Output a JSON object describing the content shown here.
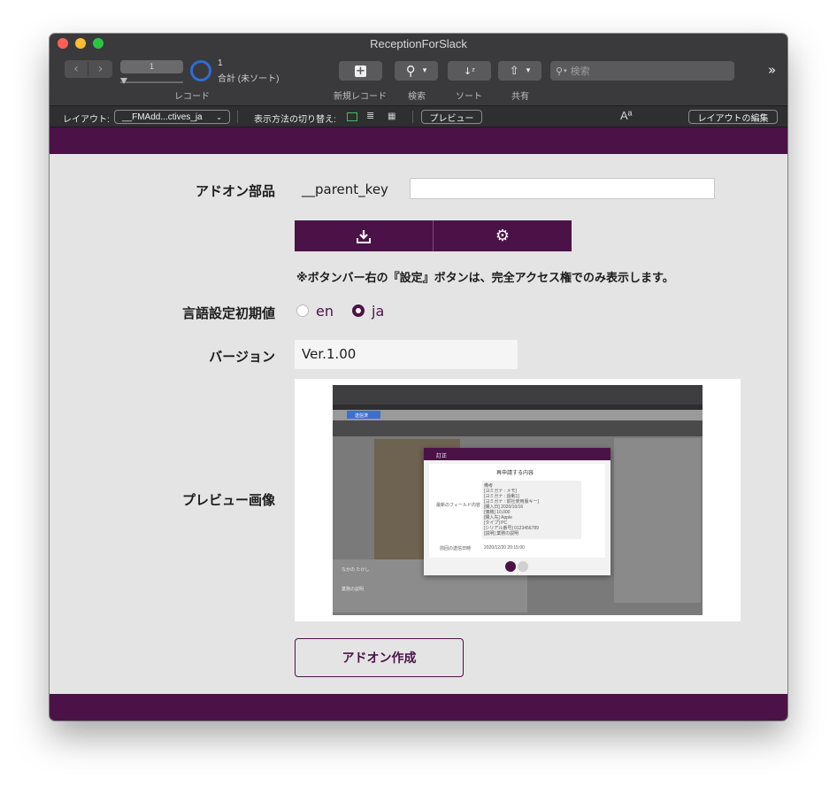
{
  "window": {
    "title": "ReceptionForSlack"
  },
  "toolbar": {
    "record_value": "1",
    "record_count": "1",
    "record_total": "合計 (未ソート)",
    "records_label": "レコード",
    "new_record_label": "新規レコード",
    "find_label": "検索",
    "sort_label": "ソート",
    "share_label": "共有",
    "search_placeholder": "検索",
    "overflow": "»"
  },
  "layout_bar": {
    "layout_label": "レイアウト:",
    "layout_value": "__FMAdd...ctives_ja",
    "view_as_label": "表示方法の切り替え:",
    "preview_button": "プレビュー",
    "text_size": "Aª",
    "edit_layout_button": "レイアウトの編集"
  },
  "form": {
    "addon_label": "アドオン部品",
    "parent_key_label": "__parent_key",
    "parent_key_value": "",
    "note": "※ボタンバー右の『設定』ボタンは、完全アクセス権でのみ表示します。",
    "language_label": "言語設定初期値",
    "lang_options": [
      {
        "label": "en",
        "selected": false
      },
      {
        "label": "ja",
        "selected": true
      }
    ],
    "version_label": "バージョン",
    "version_value": "Ver.1.00",
    "preview_label": "プレビュー画像",
    "create_button": "アドオン作成"
  },
  "preview_image": {
    "dialog_title": "訂正",
    "dialog_heading": "再申請する内容",
    "field_label": "最新のフィールド内容",
    "field_lines": [
      "備考",
      "[ヨミガナ : メモ]",
      "[ヨミガナ : 過剰1]",
      "[ヨミガナ : 前社使用版キー]",
      "[購入日] 2020/10/16",
      "[価格] 10,000",
      "[購入先] Apple",
      "[タイプ] PC",
      "[シリアル番号] 0123456789",
      "[説明] 業務の説明"
    ],
    "date_label": "前回の送信日時",
    "date_value": "2020/12/20 20:15:00",
    "name_value": "なかの たけし",
    "desc_value": "業務の説明",
    "button_label": "送信済"
  },
  "colors": {
    "brand": "#4b1248",
    "toolbar": "#3a3a3c"
  }
}
